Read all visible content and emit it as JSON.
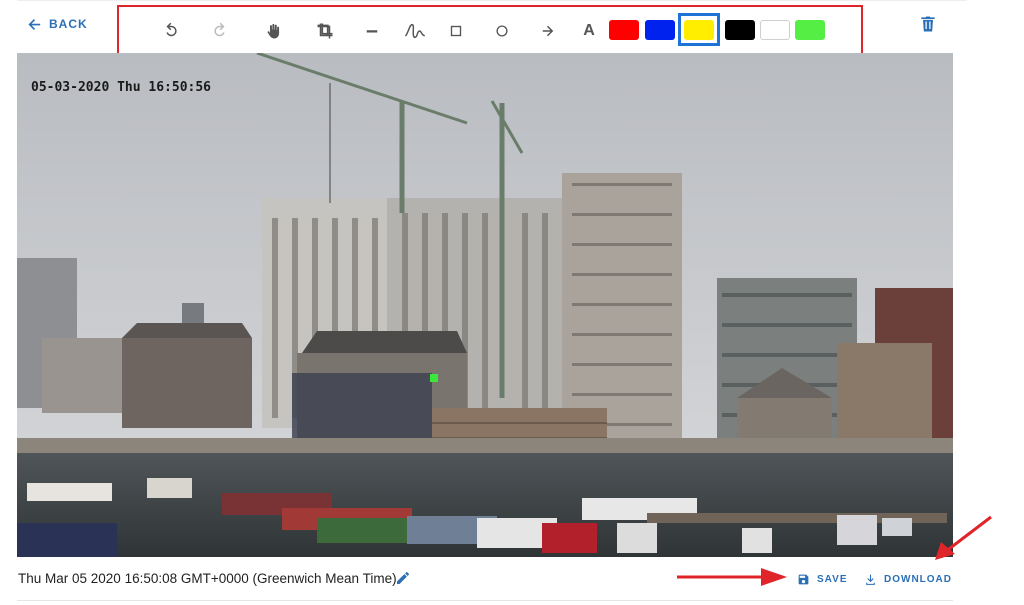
{
  "nav": {
    "back_label": "BACK"
  },
  "toolbar": {
    "tools": [
      {
        "name": "undo-icon"
      },
      {
        "name": "redo-icon"
      },
      {
        "name": "pan-hand-icon"
      },
      {
        "name": "crop-icon"
      },
      {
        "name": "line-icon"
      },
      {
        "name": "freehand-icon"
      },
      {
        "name": "rectangle-icon"
      },
      {
        "name": "circle-icon"
      },
      {
        "name": "arrow-icon"
      }
    ],
    "text_tool_label": "A",
    "colors": [
      {
        "name": "red",
        "hex": "#ff0000"
      },
      {
        "name": "blue",
        "hex": "#0022ee"
      },
      {
        "name": "yellow",
        "hex": "#ffee00",
        "selected": true
      },
      {
        "name": "black",
        "hex": "#000000"
      },
      {
        "name": "white",
        "hex": "#ffffff"
      },
      {
        "name": "green",
        "hex": "#55ee44"
      }
    ]
  },
  "photo": {
    "timestamp_overlay": "05-03-2020 Thu 16:50:56"
  },
  "footer": {
    "datetime": "Thu Mar 05 2020 16:50:08 GMT+0000 (Greenwich Mean Time)",
    "save_label": "SAVE",
    "download_label": "DOWNLOAD"
  },
  "theme": {
    "accent": "#2b6fb6",
    "highlight": "#e0252a"
  }
}
